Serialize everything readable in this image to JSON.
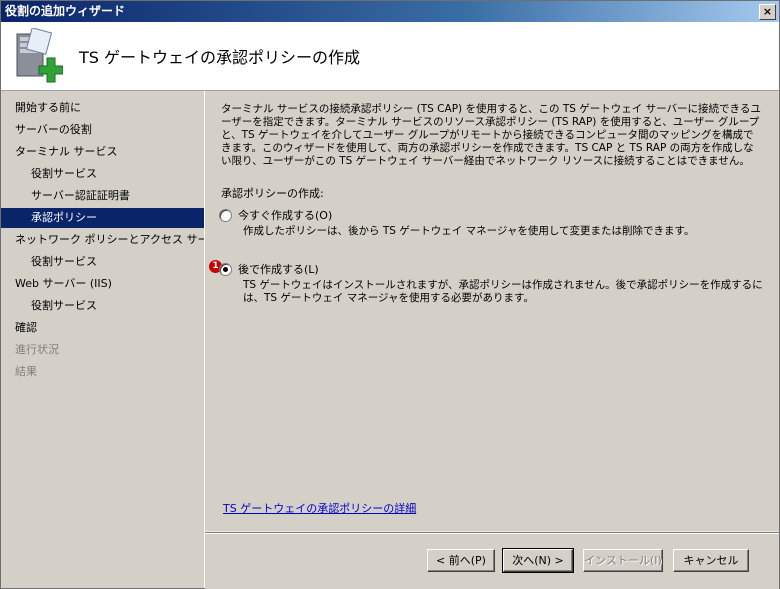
{
  "window": {
    "title": "役割の追加ウィザード",
    "close_label": "×"
  },
  "header": {
    "title": "TS ゲートウェイの承認ポリシーの作成"
  },
  "nav": {
    "items": [
      {
        "label": "開始する前に",
        "level": 0,
        "state": "normal"
      },
      {
        "label": "サーバーの役割",
        "level": 0,
        "state": "normal"
      },
      {
        "label": "ターミナル サービス",
        "level": 0,
        "state": "normal"
      },
      {
        "label": "役割サービス",
        "level": 1,
        "state": "normal"
      },
      {
        "label": "サーバー認証証明書",
        "level": 1,
        "state": "normal"
      },
      {
        "label": "承認ポリシー",
        "level": 1,
        "state": "selected"
      },
      {
        "label": "ネットワーク ポリシーとアクセス サービ...",
        "level": 0,
        "state": "normal"
      },
      {
        "label": "役割サービス",
        "level": 1,
        "state": "normal"
      },
      {
        "label": "Web サーバー (IIS)",
        "level": 0,
        "state": "normal"
      },
      {
        "label": "役割サービス",
        "level": 1,
        "state": "normal"
      },
      {
        "label": "確認",
        "level": 0,
        "state": "normal"
      },
      {
        "label": "進行状況",
        "level": 0,
        "state": "disabled"
      },
      {
        "label": "結果",
        "level": 0,
        "state": "disabled"
      }
    ]
  },
  "content": {
    "description": "ターミナル サービスの接続承認ポリシー (TS CAP) を使用すると、この TS ゲートウェイ サーバーに接続できるユーザーを指定できます。ターミナル サービスのリソース承認ポリシー (TS RAP) を使用すると、ユーザー グループと、TS ゲートウェイを介してユーザー グループがリモートから接続できるコンピュータ間のマッピングを構成できます。このウィザードを使用して、両方の承認ポリシーを作成できます。TS CAP と TS RAP の両方を作成しない限り、ユーザーがこの TS ゲートウェイ サーバー経由でネットワーク リソースに接続することはできません。",
    "group_label": "承認ポリシーの作成:",
    "option_now": {
      "label": "今すぐ作成する(O)",
      "description": "作成したポリシーは、後から TS ゲートウェイ マネージャを使用して変更または削除できます。",
      "checked": false
    },
    "option_later": {
      "label": "後で作成する(L)",
      "description": "TS ゲートウェイはインストールされますが、承認ポリシーは作成されません。後で承認ポリシーを作成するには、TS ゲートウェイ マネージャを使用する必要があります。",
      "checked": true,
      "badge": "1"
    },
    "link": "TS ゲートウェイの承認ポリシーの詳細"
  },
  "footer": {
    "back_label": "< 前へ(P)",
    "next_label": "次へ(N) >",
    "install_label": "インストール(I)",
    "cancel_label": "キャンセル"
  }
}
